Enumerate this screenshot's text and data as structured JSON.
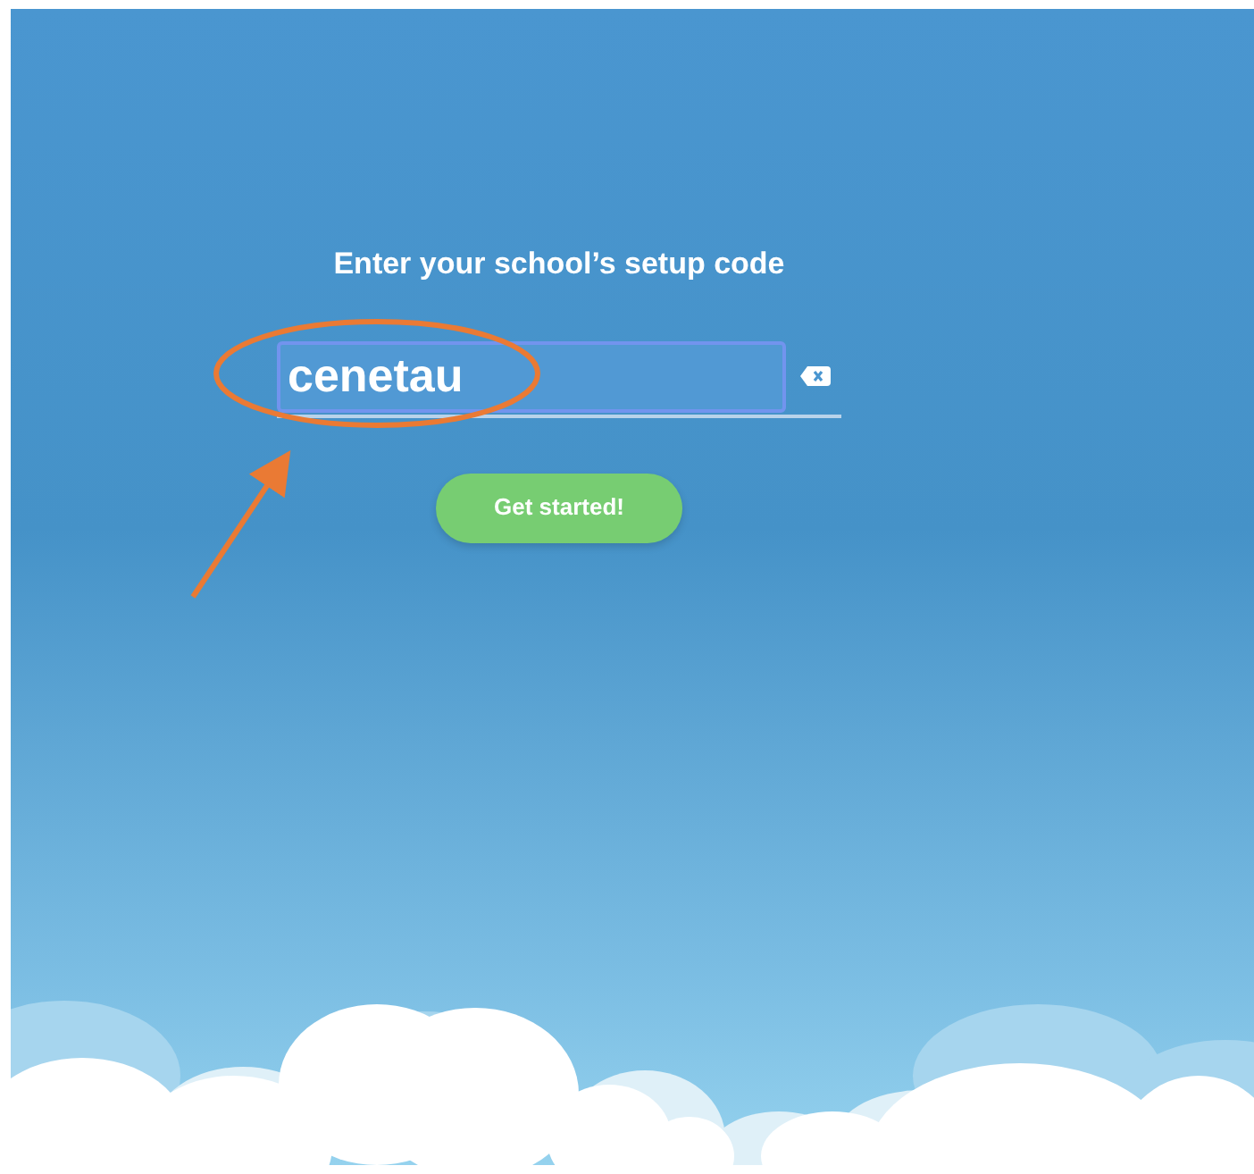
{
  "heading": "Enter your school’s setup code",
  "code_field": {
    "value": "cenetau",
    "focused": true
  },
  "button": {
    "label": "Get started!"
  }
}
